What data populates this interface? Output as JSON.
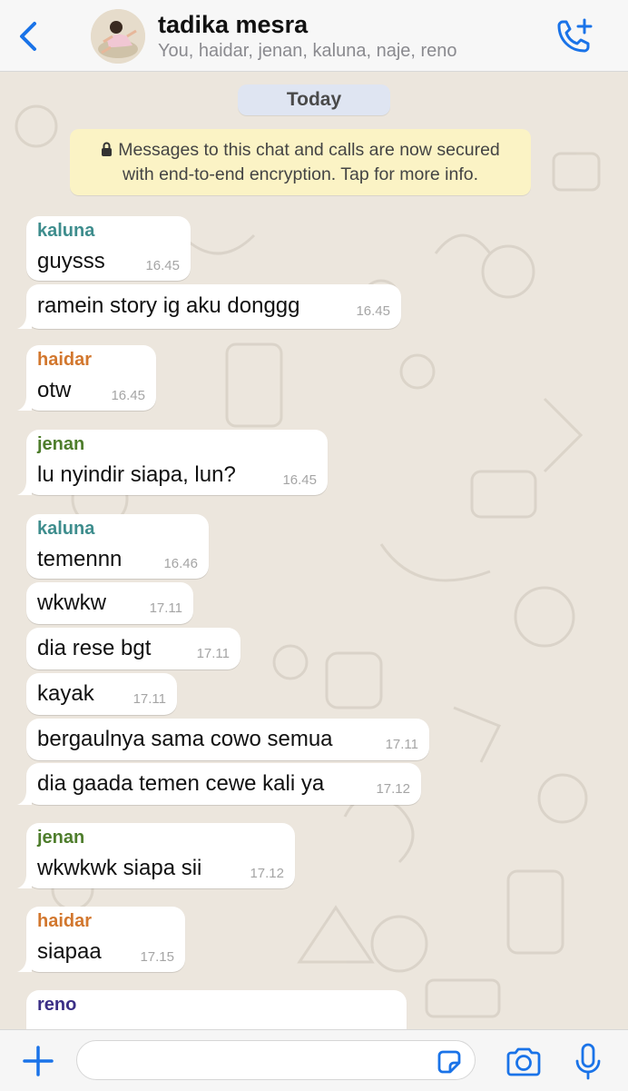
{
  "header": {
    "title": "tadika mesra",
    "members": "You, haidar, jenan, kaluna, naje, reno",
    "back_icon": "chevron-left-icon",
    "call_icon": "add-call-icon",
    "accent": "#1a73e8"
  },
  "chat": {
    "date_label": "Today",
    "encryption_line1": "Messages to this chat and calls are now secured",
    "encryption_line2": "with end-to-end encryption. Tap for more info.",
    "messages": [
      {
        "sender": "kaluna",
        "text": "guysss",
        "time": "16.45"
      },
      {
        "sender": "",
        "text": "ramein story ig aku donggg",
        "time": "16.45"
      },
      {
        "sender": "haidar",
        "text": "otw",
        "time": "16.45"
      },
      {
        "sender": "jenan",
        "text": "lu nyindir siapa, lun?",
        "time": "16.45"
      },
      {
        "sender": "kaluna",
        "text": "temennn",
        "time": "16.46"
      },
      {
        "sender": "",
        "text": "wkwkw",
        "time": "17.11"
      },
      {
        "sender": "",
        "text": "dia rese bgt",
        "time": "17.11"
      },
      {
        "sender": "",
        "text": "kayak",
        "time": "17.11"
      },
      {
        "sender": "",
        "text": "bergaulnya sama cowo semua",
        "time": "17.11"
      },
      {
        "sender": "",
        "text": "dia gaada temen cewe kali ya",
        "time": "17.12"
      },
      {
        "sender": "jenan",
        "text": "wkwkwk siapa sii",
        "time": "17.12"
      },
      {
        "sender": "haidar",
        "text": "siapaa",
        "time": "17.15"
      },
      {
        "sender": "reno",
        "text": "",
        "time": ""
      }
    ],
    "sender_colors": {
      "kaluna": "#3e8d8d",
      "haidar": "#d2772e",
      "jenan": "#4e7d2c",
      "reno": "#3b2f86"
    }
  },
  "composer": {
    "placeholder": "",
    "attach_icon": "plus-icon",
    "sticker_icon": "sticker-icon",
    "camera_icon": "camera-icon",
    "mic_icon": "microphone-icon"
  }
}
